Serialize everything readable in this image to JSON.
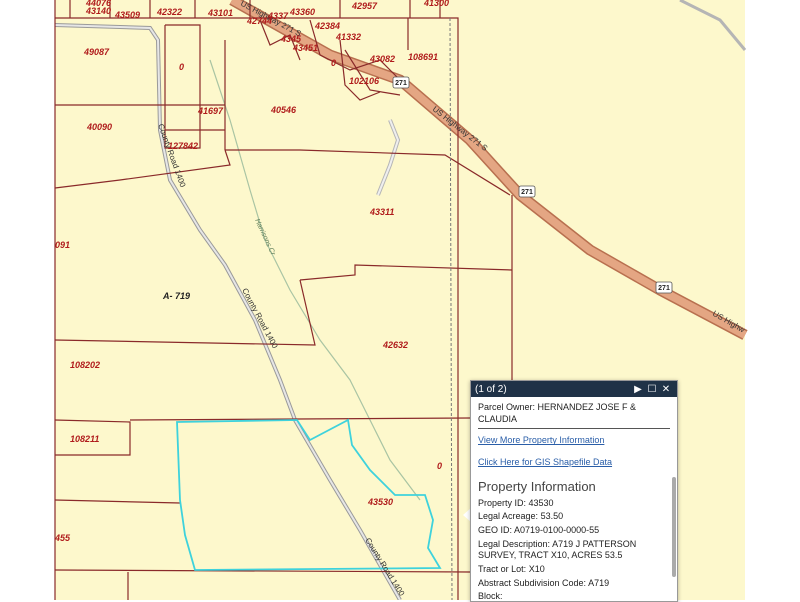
{
  "map": {
    "parcel_labels": [
      "44076",
      "43140",
      "43509",
      "42322",
      "43101",
      "42957",
      "41300",
      "42744",
      "4337",
      "43360",
      "42384",
      "41332",
      "4345",
      "43451",
      "43082",
      "108691",
      "49087",
      "0",
      "0",
      "102106",
      "40090",
      "41697",
      "40546",
      "127842",
      "43311",
      "091",
      "A- 719",
      "108202",
      "42632",
      "108211",
      "0",
      "43530",
      "455"
    ],
    "road_labels": [
      "US Highway 271 S",
      "US Highway 271 S",
      "US Highw",
      "County Road 1400",
      "County Road 1400",
      "County Road 1400",
      "Harrisons Cr"
    ],
    "highway_shields": [
      "271",
      "271",
      "271"
    ],
    "colors": {
      "background": "#fdf8cc",
      "parcel_line": "#8a2a2a",
      "highway": "#d9916a",
      "selected_parcel": "#3ed2dc"
    }
  },
  "popup": {
    "header": {
      "count": "(1 of 2)",
      "next_icon": "next-icon",
      "maximize_icon": "maximize-icon",
      "close_icon": "close-icon"
    },
    "owner_label": "Parcel Owner:",
    "owner_value": "HERNANDEZ JOSE F & CLAUDIA",
    "link_property": "View More Property Information",
    "link_gis": "Click Here for GIS Shapefile Data",
    "section_title": "Property Information",
    "fields": [
      {
        "label": "Property ID:",
        "value": "43530"
      },
      {
        "label": "Legal Acreage:",
        "value": "53.50"
      },
      {
        "label": "GEO ID:",
        "value": "A0719-0100-0000-55"
      },
      {
        "label": "Legal Description:",
        "value": "A719 J PATTERSON SURVEY, TRACT X10, ACRES 53.5"
      },
      {
        "label": "Tract or Lot:",
        "value": "X10"
      },
      {
        "label": "Abstract Subdivision Code:",
        "value": "A719"
      },
      {
        "label": "Block:",
        "value": ""
      }
    ]
  }
}
